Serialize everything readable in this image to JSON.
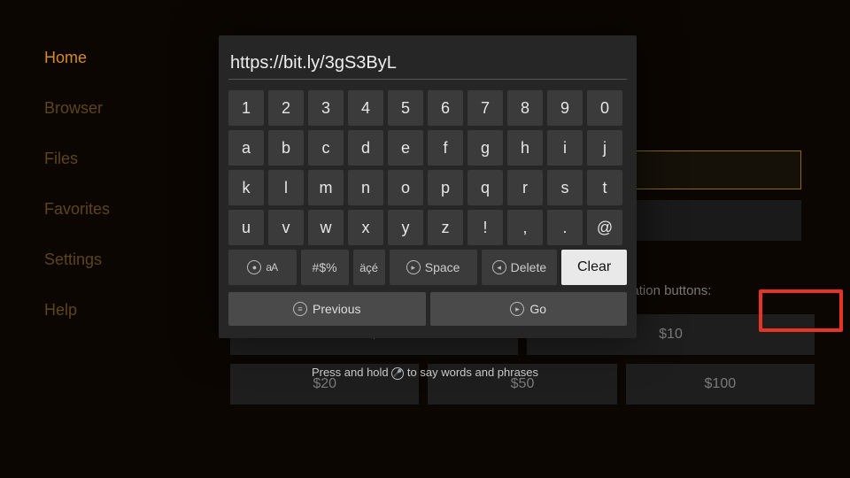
{
  "sidebar": {
    "items": [
      {
        "label": "Home",
        "selected": true
      },
      {
        "label": "Browser",
        "selected": false
      },
      {
        "label": "Files",
        "selected": false
      },
      {
        "label": "Favorites",
        "selected": false
      },
      {
        "label": "Settings",
        "selected": false
      },
      {
        "label": "Help",
        "selected": false
      }
    ]
  },
  "background": {
    "donation_hint": "ase donation buttons:",
    "donation_row1": [
      "$",
      "$10"
    ],
    "donation_row2": [
      "$20",
      "$50",
      "$100"
    ]
  },
  "modal": {
    "url": "https://bit.ly/3gS3ByL",
    "keys_row1": [
      "1",
      "2",
      "3",
      "4",
      "5",
      "6",
      "7",
      "8",
      "9",
      "0"
    ],
    "keys_row2": [
      "a",
      "b",
      "c",
      "d",
      "e",
      "f",
      "g",
      "h",
      "i",
      "j"
    ],
    "keys_row3": [
      "k",
      "l",
      "m",
      "n",
      "o",
      "p",
      "q",
      "r",
      "s",
      "t"
    ],
    "keys_row4": [
      "u",
      "v",
      "w",
      "x",
      "y",
      "z",
      "!",
      ",",
      ".",
      "@"
    ],
    "fn": {
      "shift": "aA",
      "symbols": "#$%",
      "accents": "äçé",
      "space": "Space",
      "delete": "Delete",
      "clear": "Clear"
    },
    "nav": {
      "previous": "Previous",
      "go": "Go"
    }
  },
  "hint": {
    "before": "Press and hold ",
    "after": " to say words and phrases"
  }
}
